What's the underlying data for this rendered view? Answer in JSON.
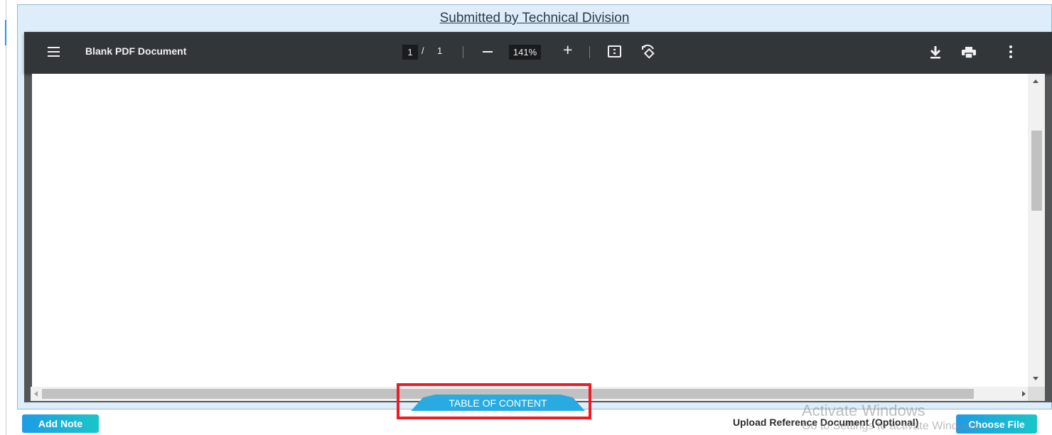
{
  "header": {
    "title": "Submitted by Technical Division"
  },
  "viewer": {
    "toolbar": {
      "document_title": "Blank PDF Document",
      "current_page": "1",
      "page_separator": "/",
      "total_pages": "1",
      "zoom": "141%",
      "plus_label": "+",
      "icons": {
        "menu": "menu-icon",
        "zoom_out": "minus-icon",
        "zoom_in": "plus-icon",
        "fit": "fit-to-page-icon",
        "rotate": "rotate-icon",
        "download": "download-icon",
        "print": "print-icon",
        "more": "more-vertical-icon"
      }
    }
  },
  "table_of_content": {
    "label": "TABLE OF CONTENT"
  },
  "footer": {
    "add_note_label": "Add Note",
    "upload_label": "Upload Reference Document (Optional)",
    "choose_file_label": "Choose File"
  },
  "watermark": {
    "line1": "Activate Windows",
    "line2": "Go to Settings to activate Windows."
  },
  "colors": {
    "toolbar_bg": "#323639",
    "frame_bg": "#ddeefa",
    "accent": "#29abe2",
    "highlight": "#ee1c25",
    "button_gradient_start": "#1e9be6",
    "button_gradient_end": "#18c7c8"
  }
}
